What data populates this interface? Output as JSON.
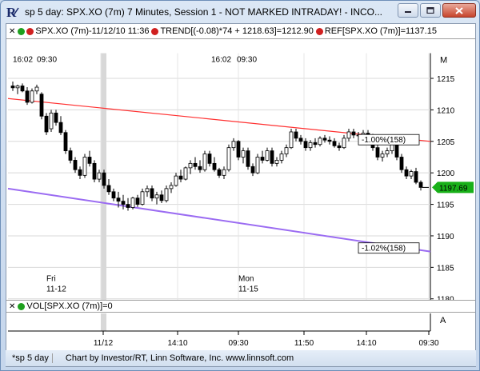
{
  "window": {
    "title": "sp 5 day: SPX.XO (7m) 7 Minutes, Session 1 - NOT MARKED INTRADAY! - INCO..."
  },
  "legend": {
    "symbol": "SPX.XO (7m)-11/12/10 11:36",
    "trend": "TREND[(-0.08)*74 + 1218.63]=1212.90",
    "ref": "REF[SPX.XO (7m)]=1137.15"
  },
  "time_labels_top": [
    "16:02",
    "09:30",
    "16:02",
    "09:30"
  ],
  "day_labels": [
    {
      "day": "Fri",
      "date": "11-12"
    },
    {
      "day": "Mon",
      "date": "11-15"
    }
  ],
  "annotations": {
    "upper_pct": "-1.00%(158)",
    "lower_pct": "-1.02%(158)",
    "last_price": "1197.69",
    "marker_m": "M",
    "marker_a": "A"
  },
  "vol_legend": "VOL[SPX.XO (7m)]=0",
  "x_axis_labels": [
    "11/12",
    "14:10",
    "09:30",
    "11:50",
    "14:10",
    "09:30"
  ],
  "status": {
    "tab": "*sp 5 day",
    "credit": "Chart by Investor/RT, Linn Software, Inc. www.linnsoft.com"
  },
  "colors": {
    "up_candle": "#ffffff",
    "down_candle": "#000000",
    "upper_trend": "#ff3030",
    "lower_trend": "#9b6cf2",
    "last_price_bg": "#18b018"
  },
  "chart_data": {
    "type": "candlestick",
    "y_ticks": [
      1215,
      1210,
      1205,
      1200,
      1195,
      1190,
      1185,
      1180
    ],
    "ylim": [
      1178,
      1219
    ],
    "grid": true,
    "upper_trend": {
      "start": 1211.8,
      "end": 1205.0
    },
    "lower_trend": {
      "start": 1197.5,
      "end": 1187.5
    },
    "last": 1197.69,
    "candles": [
      [
        1213.8,
        1214.5,
        1213.0,
        1213.5
      ],
      [
        1213.5,
        1214.0,
        1212.5,
        1213.8
      ],
      [
        1213.8,
        1214.2,
        1212.8,
        1213.0
      ],
      [
        1213.0,
        1213.6,
        1210.8,
        1211.2
      ],
      [
        1211.2,
        1213.4,
        1211.0,
        1213.0
      ],
      [
        1213.0,
        1214.0,
        1212.5,
        1213.6
      ],
      [
        1212.5,
        1212.8,
        1208.5,
        1209.0
      ],
      [
        1209.0,
        1209.5,
        1206.0,
        1206.5
      ],
      [
        1207.0,
        1210.0,
        1206.5,
        1209.5
      ],
      [
        1209.5,
        1210.0,
        1207.5,
        1208.0
      ],
      [
        1208.0,
        1209.0,
        1206.0,
        1206.4
      ],
      [
        1206.4,
        1206.8,
        1203.0,
        1203.5
      ],
      [
        1203.5,
        1204.0,
        1201.5,
        1202.0
      ],
      [
        1202.0,
        1202.5,
        1200.0,
        1200.5
      ],
      [
        1200.5,
        1201.0,
        1199.0,
        1199.6
      ],
      [
        1199.6,
        1203.0,
        1199.2,
        1202.5
      ],
      [
        1202.5,
        1203.5,
        1201.0,
        1201.5
      ],
      [
        1201.5,
        1202.0,
        1198.5,
        1199.0
      ],
      [
        1199.0,
        1200.5,
        1198.5,
        1200.0
      ],
      [
        1200.0,
        1200.5,
        1197.5,
        1198.0
      ],
      [
        1198.0,
        1199.0,
        1196.5,
        1197.0
      ],
      [
        1197.0,
        1197.5,
        1195.5,
        1196.0
      ],
      [
        1196.0,
        1197.0,
        1194.5,
        1195.5
      ],
      [
        1195.5,
        1196.5,
        1194.2,
        1195.0
      ],
      [
        1195.0,
        1196.0,
        1194.0,
        1194.5
      ],
      [
        1194.5,
        1196.2,
        1194.2,
        1196.0
      ],
      [
        1196.0,
        1196.5,
        1194.6,
        1195.0
      ],
      [
        1195.0,
        1197.5,
        1194.8,
        1197.0
      ],
      [
        1197.0,
        1198.0,
        1196.2,
        1197.5
      ],
      [
        1197.5,
        1198.0,
        1195.5,
        1196.0
      ],
      [
        1196.0,
        1197.0,
        1195.0,
        1196.5
      ],
      [
        1196.5,
        1197.2,
        1195.2,
        1195.6
      ],
      [
        1195.6,
        1198.0,
        1195.3,
        1197.5
      ],
      [
        1197.5,
        1198.5,
        1196.8,
        1198.0
      ],
      [
        1198.0,
        1200.0,
        1197.8,
        1199.5
      ],
      [
        1199.5,
        1200.5,
        1198.5,
        1199.0
      ],
      [
        1199.0,
        1201.0,
        1198.8,
        1200.8
      ],
      [
        1200.8,
        1202.0,
        1199.8,
        1201.5
      ],
      [
        1201.5,
        1202.5,
        1200.5,
        1201.0
      ],
      [
        1201.0,
        1202.0,
        1200.0,
        1200.5
      ],
      [
        1200.5,
        1203.5,
        1200.2,
        1203.0
      ],
      [
        1203.0,
        1203.5,
        1201.0,
        1201.5
      ],
      [
        1201.5,
        1202.5,
        1200.2,
        1200.5
      ],
      [
        1200.5,
        1200.8,
        1199.2,
        1199.6
      ],
      [
        1199.6,
        1201.0,
        1199.0,
        1200.5
      ],
      [
        1200.5,
        1204.5,
        1200.2,
        1204.0
      ],
      [
        1204.0,
        1205.5,
        1203.5,
        1205.0
      ],
      [
        1205.0,
        1205.2,
        1202.0,
        1202.5
      ],
      [
        1202.5,
        1204.0,
        1201.5,
        1203.5
      ],
      [
        1203.5,
        1204.0,
        1200.5,
        1201.0
      ],
      [
        1201.0,
        1201.5,
        1199.5,
        1200.0
      ],
      [
        1200.0,
        1203.0,
        1199.8,
        1202.5
      ],
      [
        1202.5,
        1203.5,
        1201.5,
        1202.0
      ],
      [
        1202.0,
        1204.0,
        1201.8,
        1203.5
      ],
      [
        1203.5,
        1204.0,
        1201.0,
        1201.5
      ],
      [
        1201.5,
        1202.5,
        1201.0,
        1202.0
      ],
      [
        1202.0,
        1203.5,
        1201.5,
        1203.0
      ],
      [
        1203.0,
        1204.5,
        1202.5,
        1204.0
      ],
      [
        1204.0,
        1207.0,
        1203.8,
        1206.5
      ],
      [
        1206.5,
        1207.0,
        1205.0,
        1205.5
      ],
      [
        1205.5,
        1206.0,
        1204.5,
        1205.0
      ],
      [
        1205.0,
        1205.5,
        1203.5,
        1204.0
      ],
      [
        1204.0,
        1205.2,
        1203.5,
        1204.8
      ],
      [
        1204.8,
        1205.5,
        1204.0,
        1204.5
      ],
      [
        1204.5,
        1205.8,
        1204.2,
        1205.5
      ],
      [
        1205.5,
        1206.0,
        1204.8,
        1205.2
      ],
      [
        1205.2,
        1205.8,
        1204.5,
        1205.0
      ],
      [
        1205.0,
        1205.5,
        1204.0,
        1204.3
      ],
      [
        1204.3,
        1204.8,
        1203.5,
        1204.0
      ],
      [
        1204.0,
        1206.0,
        1203.8,
        1205.5
      ],
      [
        1205.5,
        1207.0,
        1205.0,
        1206.5
      ],
      [
        1206.5,
        1207.0,
        1205.5,
        1206.0
      ],
      [
        1206.0,
        1206.5,
        1205.2,
        1206.0
      ],
      [
        1206.0,
        1206.8,
        1205.5,
        1206.3
      ],
      [
        1206.3,
        1206.8,
        1205.5,
        1205.8
      ],
      [
        1205.8,
        1206.2,
        1203.5,
        1204.0
      ],
      [
        1204.0,
        1204.5,
        1202.0,
        1202.5
      ],
      [
        1202.5,
        1203.5,
        1201.8,
        1203.0
      ],
      [
        1203.0,
        1204.0,
        1202.5,
        1203.5
      ],
      [
        1203.5,
        1205.0,
        1203.0,
        1204.5
      ],
      [
        1204.5,
        1204.8,
        1202.0,
        1202.5
      ],
      [
        1202.5,
        1203.0,
        1200.0,
        1200.5
      ],
      [
        1200.5,
        1201.0,
        1199.0,
        1199.5
      ],
      [
        1199.5,
        1200.5,
        1199.0,
        1200.2
      ],
      [
        1200.2,
        1200.8,
        1198.2,
        1198.5
      ],
      [
        1198.5,
        1198.8,
        1197.2,
        1197.69
      ]
    ]
  }
}
